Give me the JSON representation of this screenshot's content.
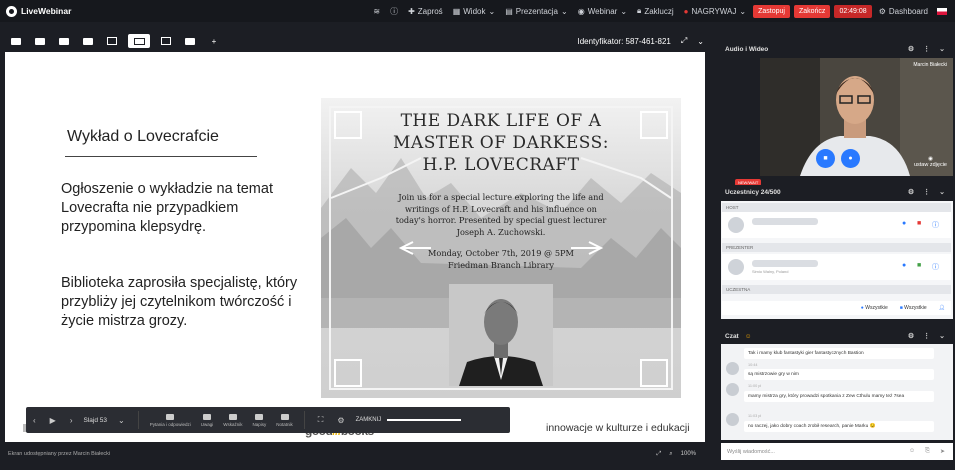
{
  "topbar": {
    "brand": "LiveWebinar",
    "items": [
      {
        "icon": "wifi-icon",
        "label": ""
      },
      {
        "icon": "info-icon",
        "label": ""
      },
      {
        "icon": "invite-icon",
        "label": "Zaproś"
      },
      {
        "icon": "view-icon",
        "label": "Widok"
      },
      {
        "icon": "presentation-icon",
        "label": "Prezentacja"
      },
      {
        "icon": "webinar-icon",
        "label": "Webinar"
      },
      {
        "icon": "lock-icon",
        "label": "Zakluczj"
      },
      {
        "icon": "record-icon",
        "label": "NAGRYWAJ"
      }
    ],
    "btn_record": "Zastopuj",
    "btn_end": "Zakończ",
    "timer": "02:49:08",
    "dashboard": "Dashboard"
  },
  "ptoolbar": {
    "identifier": "Identyfikator: 587-461-821"
  },
  "slide": {
    "title": "Wykład o Lovecrafcie",
    "para1": "Ogłoszenie o wykładzie na temat Lovecrafta nie przypadkiem przypomina klepsydrę.",
    "para2": "Biblioteka zaprosiła specjalistę, który przybliży jej czytelnikom twórczość i życie mistrza grozy.",
    "poster_title_1": "THE DARK LIFE OF A",
    "poster_title_2": "MASTER OF DARKESS:",
    "poster_title_3": "H.P. LOVECRAFT",
    "poster_body": "Join us for a special lecture exploring the life and writings of H.P. Lovecraft and his influence on today's horror. Presented by special guest lecturer Joseph A. Zuchowski.",
    "poster_date_1": "Monday, October 7th, 2019 @ 5PM",
    "poster_date_2": "Friedman Branch Library",
    "footer_brand_1": "good",
    "footer_brand_2": "books",
    "footer_right": "innowacje w kulturze i edukacji"
  },
  "controls": {
    "slide_label": "Slajd 53",
    "tools": [
      "Pytania i odpowiedzi",
      "Uwagi",
      "Wskaźnik",
      "Napisy",
      "Notatnik"
    ],
    "zoom_label": "ZAMKNIJ"
  },
  "status": {
    "left": "Ekran udostępniany przez Marcin Białecki",
    "zoom": "100%"
  },
  "audio_video": {
    "title": "Audio i Wideo",
    "presenter_name": "Marcin Białecki",
    "set_photo": "ustaw zdjęcie"
  },
  "participants": {
    "badge": "NEW/WAIT",
    "title": "Uczestnicy 24/500",
    "host_label": "HOST",
    "presenter_label": "PREZENTER",
    "presenter_sub": "Simio Walny, Poland",
    "participants_label": "UCZESTNA",
    "mute_all": "Wszystkie",
    "video_all": "Wszystkie"
  },
  "chat": {
    "title": "Czat",
    "messages": [
      {
        "meta": "",
        "text": "Tak i mamy klub fantastyki gier fantastycznych Bastion"
      },
      {
        "meta": "10:44",
        "text": "są mistrzowie gry w nim"
      },
      {
        "meta": "11:00 pl",
        "text": "mamy mistrza gry, który prowadzi spotkania z Zew Cthulu mamy też 7sea"
      },
      {
        "meta": "11:03 pl",
        "text": "no raczej, jako dobry coach zrobił research, panie Marku 😉"
      }
    ],
    "placeholder": "Wyślij wiadomość..."
  }
}
